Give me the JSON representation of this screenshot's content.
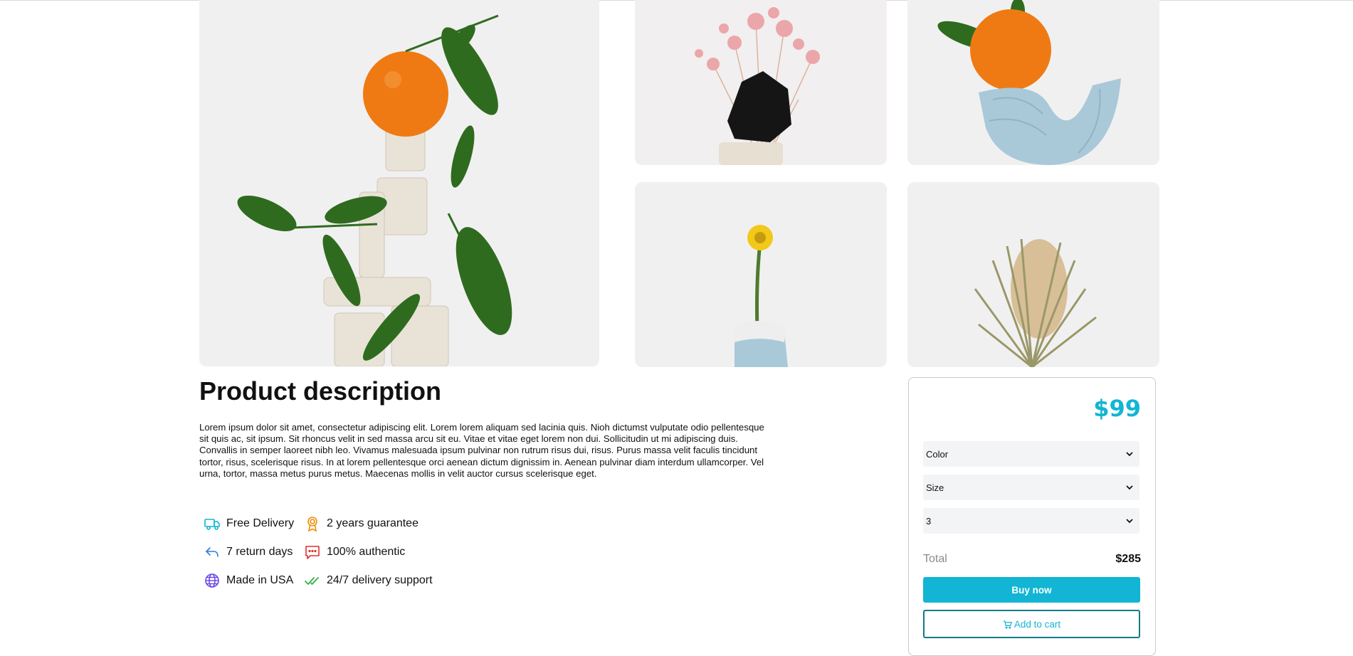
{
  "gallery": {
    "images": [
      {
        "icon": "orange-on-clay-tower-photo"
      },
      {
        "icon": "black-rock-with-pink-flowers-photo"
      },
      {
        "icon": "orange-on-blue-clay-photo"
      },
      {
        "icon": "yellow-flower-in-blue-vase-photo"
      },
      {
        "icon": "dried-banksia-flower-photo"
      }
    ]
  },
  "product": {
    "title": "Product description",
    "paragraph1": "Lorem ipsum dolor sit amet, consectetur adipiscing elit. Lorem lorem aliquam sed lacinia quis. Nioh dictumst vulputate odio pellentesque sit quis ac, sit ipsum. Sit rhoncus velit in sed massa arcu sit eu. Vitae et vitae eget lorem non dui. Sollicitudin ut mi adipiscing duis.",
    "paragraph2": "Convallis in semper laoreet nibh leo. Vivamus malesuada ipsum pulvinar non rutrum risus dui, risus. Purus massa velit faculis tincidunt tortor, risus, scelerisque risus. In at lorem pellentesque orci aenean dictum dignissim in. Aenean pulvinar diam interdum ullamcorper. Vel urna, tortor, massa metus purus metus. Maecenas mollis in velit auctor cursus scelerisque eget."
  },
  "features": [
    {
      "label": "Free Delivery",
      "icon": "truck-icon",
      "color": "#12b5d4"
    },
    {
      "label": "2 years guarantee",
      "icon": "award-icon",
      "color": "#f08c00"
    },
    {
      "label": "7 return days",
      "icon": "return-arrow-icon",
      "color": "#2f7ed8"
    },
    {
      "label": "100% authentic",
      "icon": "message-icon",
      "color": "#e03131"
    },
    {
      "label": "Made in USA",
      "icon": "globe-icon",
      "color": "#7048e8"
    },
    {
      "label": "24/7 delivery support",
      "icon": "double-check-icon",
      "color": "#2fb344"
    }
  ],
  "purchase": {
    "price": "$99",
    "selects": [
      {
        "value": "Color"
      },
      {
        "value": "Size"
      },
      {
        "value": "3"
      }
    ],
    "total_label": "Total",
    "total_value": "$285",
    "buy_label": "Buy now",
    "cart_label": "Add to cart",
    "accent_color": "#12b5d4"
  }
}
